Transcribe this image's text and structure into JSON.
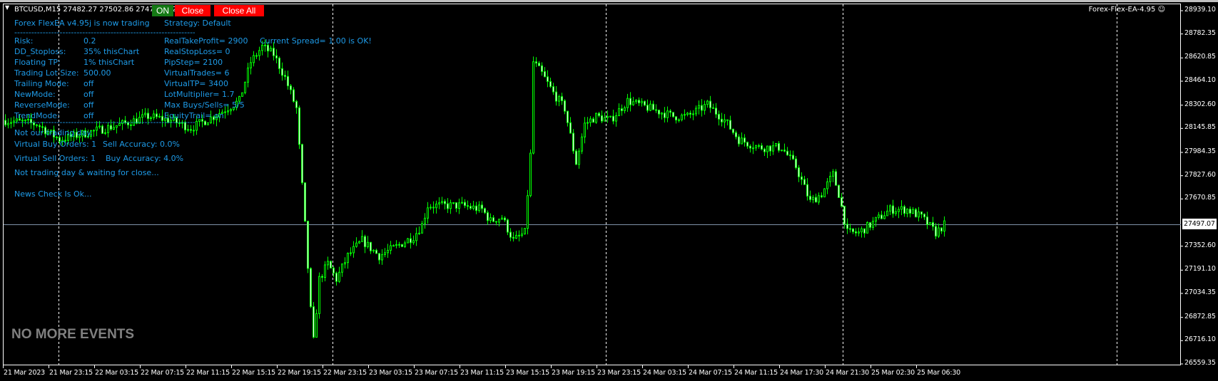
{
  "header": {
    "symbol_info": "BTCUSD,M15  27482.27 27502.86 27470.43 27497.07",
    "on_button": "ON",
    "close_button": "Close",
    "close_all_button": "Close All",
    "ea_label": "Forex-Flex-EA-4.95",
    "ea_icon": "smiley-icon"
  },
  "colors": {
    "panel_text": "#1e9be8",
    "candle": "#00ff00",
    "on": "#157a15",
    "close": "#ff0000"
  },
  "panel": {
    "title": "Forex FlexEA v4.95j is now trading",
    "strategy": "Strategy: Default",
    "separator": "------------------------------------------------------------------------",
    "rows": [
      {
        "label": "Risk:",
        "value": "0.2",
        "right": "RealTakeProfit= 2900"
      },
      {
        "label": "DD_Stoploss:",
        "value": "35%  thisChart",
        "right": "RealStopLoss= 0"
      },
      {
        "label": "Floating TP:",
        "value": "1%  thisChart",
        "right": "PipStep= 2100"
      },
      {
        "label": "Trading Lot Size:",
        "value": "500.00",
        "right": "VirtualTrades= 6"
      },
      {
        "label": "Trailing Mode:",
        "value": "off",
        "right": "VirtualTP= 3400"
      },
      {
        "label": "NewMode:",
        "value": "off",
        "right": "LotMultiplier= 1.7"
      },
      {
        "label": "ReverseMode:",
        "value": "off",
        "right": "Max Buys/Sells= 5/5"
      },
      {
        "label": "TrendMode:",
        "value": "off",
        "right": "EquityTrail= on"
      }
    ],
    "spread": "Current Spread= 1.00 is OK!",
    "not_trading_day": "Not our trading day.",
    "virtual_buy": "Virtual Buy Orders: 1",
    "sell_accuracy": "Sell Accuracy: 0.0%",
    "virtual_sell": "Virtual Sell Orders: 1",
    "buy_accuracy": "Buy Accuracy: 4.0%",
    "waiting": "Not trading day & waiting for close...",
    "news": "News Check Is Ok...",
    "events": "NO MORE EVENTS"
  },
  "price_axis": [
    "28939.10",
    "28782.35",
    "28620.85",
    "28464.10",
    "28302.60",
    "28145.85",
    "27984.35",
    "27827.60",
    "27670.85",
    "27352.60",
    "27191.10",
    "27034.35",
    "26872.85",
    "26716.10",
    "26559.35"
  ],
  "current_price": "27497.07",
  "time_axis": [
    "21 Mar 2023",
    "21 Mar 23:15",
    "22 Mar 03:15",
    "22 Mar 07:15",
    "22 Mar 11:15",
    "22 Mar 15:15",
    "22 Mar 19:15",
    "22 Mar 23:15",
    "23 Mar 03:15",
    "23 Mar 07:15",
    "23 Mar 11:15",
    "23 Mar 15:15",
    "23 Mar 19:15",
    "23 Mar 23:15",
    "24 Mar 03:15",
    "24 Mar 07:15",
    "24 Mar 11:15",
    "24 Mar 17:30",
    "24 Mar 21:30",
    "25 Mar 02:30",
    "25 Mar 06:30"
  ],
  "chart_data": {
    "type": "candlestick",
    "timeframe": "M15",
    "ylim": [
      26559.35,
      28939.1
    ],
    "close_keypoints": [
      [
        0,
        28200
      ],
      [
        11,
        28175
      ],
      [
        19,
        28071
      ],
      [
        30,
        28123
      ],
      [
        41,
        28175
      ],
      [
        50,
        28227
      ],
      [
        58,
        28201
      ],
      [
        65,
        28149
      ],
      [
        73,
        28227
      ],
      [
        82,
        28332
      ],
      [
        86,
        28593
      ],
      [
        90,
        28697
      ],
      [
        94,
        28645
      ],
      [
        98,
        28488
      ],
      [
        102,
        28280
      ],
      [
        105,
        27496
      ],
      [
        107,
        26921
      ],
      [
        108,
        26712
      ],
      [
        110,
        27130
      ],
      [
        113,
        27234
      ],
      [
        116,
        27130
      ],
      [
        120,
        27287
      ],
      [
        125,
        27391
      ],
      [
        131,
        27287
      ],
      [
        136,
        27339
      ],
      [
        143,
        27417
      ],
      [
        146,
        27496
      ],
      [
        148,
        27626
      ],
      [
        152,
        27626
      ],
      [
        160,
        27626
      ],
      [
        167,
        27600
      ],
      [
        170,
        27522
      ],
      [
        174,
        27548
      ],
      [
        178,
        27391
      ],
      [
        182,
        27443
      ],
      [
        184,
        27966
      ],
      [
        185,
        28593
      ],
      [
        188,
        28515
      ],
      [
        192,
        28384
      ],
      [
        196,
        28280
      ],
      [
        200,
        27914
      ],
      [
        203,
        28175
      ],
      [
        207,
        28227
      ],
      [
        212,
        28201
      ],
      [
        218,
        28332
      ],
      [
        226,
        28280
      ],
      [
        234,
        28227
      ],
      [
        239,
        28227
      ],
      [
        246,
        28306
      ],
      [
        252,
        28201
      ],
      [
        257,
        28071
      ],
      [
        264,
        28018
      ],
      [
        272,
        28018
      ],
      [
        277,
        27888
      ],
      [
        282,
        27652
      ],
      [
        286,
        27705
      ],
      [
        290,
        27835
      ],
      [
        292,
        27705
      ],
      [
        295,
        27443
      ],
      [
        299,
        27443
      ],
      [
        303,
        27496
      ],
      [
        310,
        27600
      ],
      [
        316,
        27600
      ],
      [
        321,
        27548
      ],
      [
        326,
        27443
      ],
      [
        329,
        27497
      ]
    ]
  }
}
